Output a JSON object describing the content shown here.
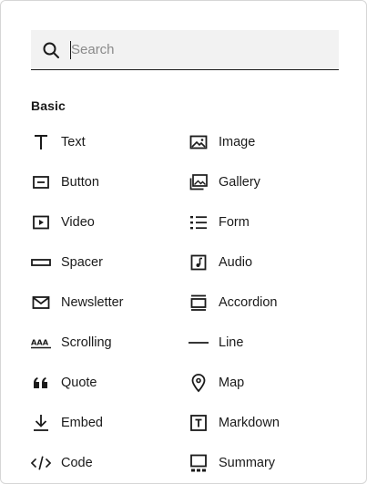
{
  "search": {
    "placeholder": "Search",
    "value": ""
  },
  "section": {
    "title": "Basic"
  },
  "items": [
    {
      "label": "Text",
      "icon": "text-icon"
    },
    {
      "label": "Image",
      "icon": "image-icon"
    },
    {
      "label": "Button",
      "icon": "button-icon"
    },
    {
      "label": "Gallery",
      "icon": "gallery-icon"
    },
    {
      "label": "Video",
      "icon": "video-icon"
    },
    {
      "label": "Form",
      "icon": "form-icon"
    },
    {
      "label": "Spacer",
      "icon": "spacer-icon"
    },
    {
      "label": "Audio",
      "icon": "audio-icon"
    },
    {
      "label": "Newsletter",
      "icon": "newsletter-icon"
    },
    {
      "label": "Accordion",
      "icon": "accordion-icon"
    },
    {
      "label": "Scrolling",
      "icon": "scrolling-icon"
    },
    {
      "label": "Line",
      "icon": "line-icon"
    },
    {
      "label": "Quote",
      "icon": "quote-icon"
    },
    {
      "label": "Map",
      "icon": "map-icon"
    },
    {
      "label": "Embed",
      "icon": "embed-icon"
    },
    {
      "label": "Markdown",
      "icon": "markdown-icon"
    },
    {
      "label": "Code",
      "icon": "code-icon"
    },
    {
      "label": "Summary",
      "icon": "summary-icon"
    }
  ]
}
